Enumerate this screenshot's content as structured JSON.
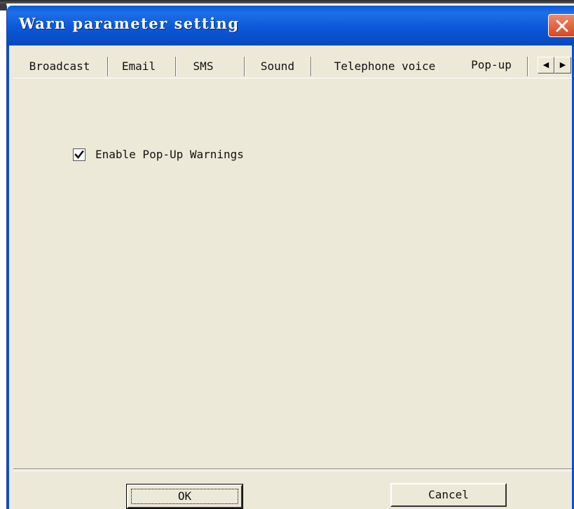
{
  "window": {
    "title": "Warn parameter setting"
  },
  "tabs": [
    {
      "label": "Broadcast"
    },
    {
      "label": "Email"
    },
    {
      "label": "SMS"
    },
    {
      "label": "Sound"
    },
    {
      "label": "Telephone voice"
    },
    {
      "label": "Pop-up",
      "active": true
    }
  ],
  "tab_scroll": {
    "left_arrow": "◀",
    "right_arrow": "▶"
  },
  "popup_panel": {
    "enable_label": "Enable Pop-Up Warnings",
    "enable_checked": true
  },
  "buttons": {
    "ok_label": "OK",
    "cancel_label": "Cancel"
  },
  "colors": {
    "titlebar": "#0b58d8",
    "dialog_face": "#ece9d8",
    "close_button": "#d8461f"
  },
  "icons": {
    "close": "close-icon",
    "check": "checkmark-icon"
  }
}
